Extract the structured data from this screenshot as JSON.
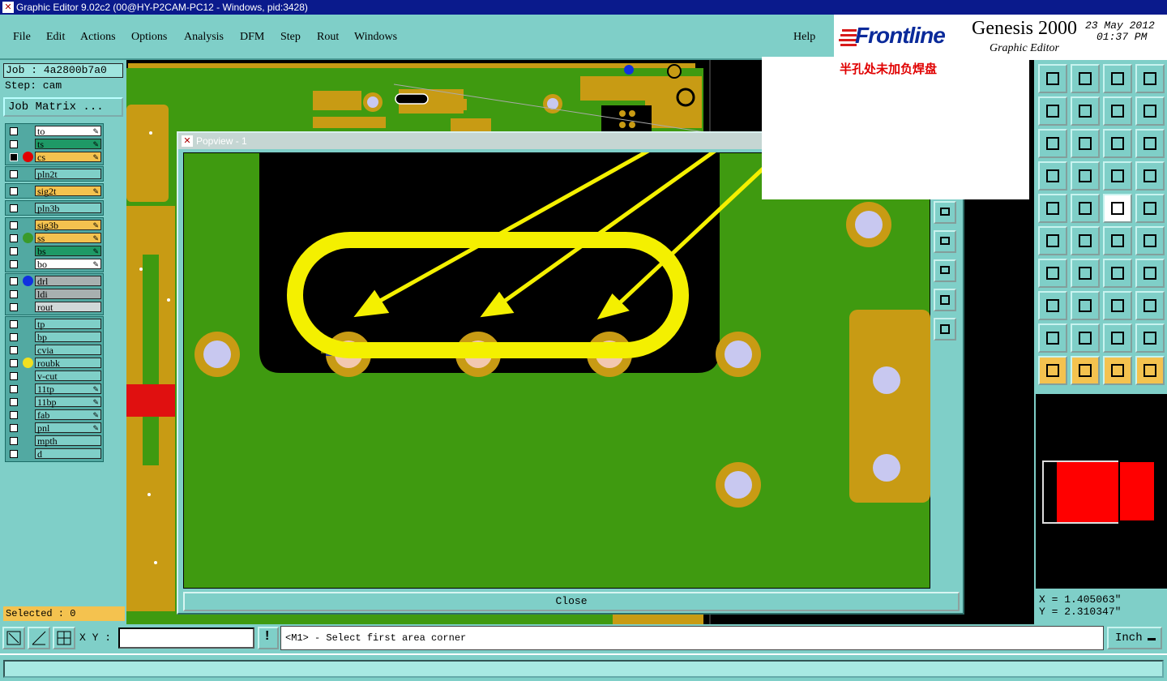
{
  "window": {
    "title": "Graphic Editor 9.02c2 (00@HY-P2CAM-PC12 - Windows, pid:3428)"
  },
  "menu": {
    "file": "File",
    "edit": "Edit",
    "actions": "Actions",
    "options": "Options",
    "analysis": "Analysis",
    "dfm": "DFM",
    "step": "Step",
    "rout": "Rout",
    "windows": "Windows",
    "help": "Help"
  },
  "brand": {
    "logo": "Frontline",
    "product": "Genesis 2000",
    "subtitle": "Graphic Editor",
    "date": "23 May 2012",
    "time": "01:37 PM"
  },
  "job": {
    "label": "Job : 4a2800b7a0",
    "step": "Step: cam",
    "matrix_button": "Job Matrix ..."
  },
  "layers": {
    "group1": [
      {
        "name": "to",
        "color": "#ffffff",
        "dot": "",
        "edit": true,
        "sel": false
      },
      {
        "name": "ts",
        "color": "#1e9966",
        "dot": "",
        "edit": true,
        "sel": false
      },
      {
        "name": "cs",
        "color": "#f4c24f",
        "dot": "#e00000",
        "edit": true,
        "sel": true
      }
    ],
    "group2": [
      {
        "name": "pln2t",
        "color": "#7fcfc8",
        "dot": "",
        "edit": false,
        "sel": false
      }
    ],
    "group3": [
      {
        "name": "sig2t",
        "color": "#f4c24f",
        "dot": "",
        "edit": true,
        "sel": false
      }
    ],
    "group4": [
      {
        "name": "pln3b",
        "color": "#7fcfc8",
        "dot": "",
        "edit": false,
        "sel": false
      }
    ],
    "group5": [
      {
        "name": "sig3b",
        "color": "#f4c24f",
        "dot": "",
        "edit": true,
        "sel": false
      },
      {
        "name": "ss",
        "color": "#f4c24f",
        "dot": "#3a9a2a",
        "edit": true,
        "sel": false
      },
      {
        "name": "bs",
        "color": "#1e9966",
        "dot": "",
        "edit": true,
        "sel": false
      },
      {
        "name": "bo",
        "color": "#ffffff",
        "dot": "",
        "edit": true,
        "sel": false
      }
    ],
    "group6": [
      {
        "name": "drl",
        "color": "#a8b0b0",
        "dot": "#1030e0",
        "edit": false,
        "sel": false
      },
      {
        "name": "ldi",
        "color": "#a8b0b0",
        "dot": "",
        "edit": false,
        "sel": false
      },
      {
        "name": "rout",
        "color": "#d0d8d8",
        "dot": "",
        "edit": false,
        "sel": false
      }
    ],
    "group7": [
      {
        "name": "tp",
        "color": "#7fcfc8",
        "dot": "",
        "edit": false,
        "sel": false
      },
      {
        "name": "bp",
        "color": "#7fcfc8",
        "dot": "",
        "edit": false,
        "sel": false
      },
      {
        "name": "cvia",
        "color": "#7fcfc8",
        "dot": "",
        "edit": false,
        "sel": false
      },
      {
        "name": "roubk",
        "color": "#7fcfc8",
        "dot": "#f0e020",
        "edit": false,
        "sel": false
      },
      {
        "name": "v-cut",
        "color": "#7fcfc8",
        "dot": "",
        "edit": false,
        "sel": false
      },
      {
        "name": "11tp",
        "color": "#7fcfc8",
        "dot": "",
        "edit": true,
        "sel": false
      },
      {
        "name": "11bp",
        "color": "#7fcfc8",
        "dot": "",
        "edit": true,
        "sel": false
      },
      {
        "name": "fab",
        "color": "#7fcfc8",
        "dot": "",
        "edit": true,
        "sel": false
      },
      {
        "name": "pnl",
        "color": "#7fcfc8",
        "dot": "",
        "edit": true,
        "sel": false
      },
      {
        "name": "mpth",
        "color": "#7fcfc8",
        "dot": "",
        "edit": false,
        "sel": false
      },
      {
        "name": "d",
        "color": "#7fcfc8",
        "dot": "",
        "edit": false,
        "sel": false
      }
    ]
  },
  "selected": "Selected : 0",
  "popview": {
    "title": "Popview - 1",
    "close": "Close"
  },
  "annotation": {
    "text": "半孔处未加负焊盘",
    "color": "#e00000"
  },
  "coords": {
    "x": "X = 1.405063\"",
    "y": "Y = 2.310347\""
  },
  "bottom": {
    "xy_label": "X Y :",
    "xy_value": "",
    "prompt": "<M1> - Select first area corner",
    "unit": "Inch"
  },
  "colors": {
    "board_green": "#3f9a10",
    "copper": "#c89b14",
    "highlight": "#f4f000",
    "drill": "#c8c8f0",
    "teal": "#7fcfc8"
  },
  "icons": [
    "checkbox-icon",
    "edit-icon",
    "arrow-icon",
    "pan-icon",
    "zoom-icon",
    "measure-icon",
    "select-icon"
  ]
}
